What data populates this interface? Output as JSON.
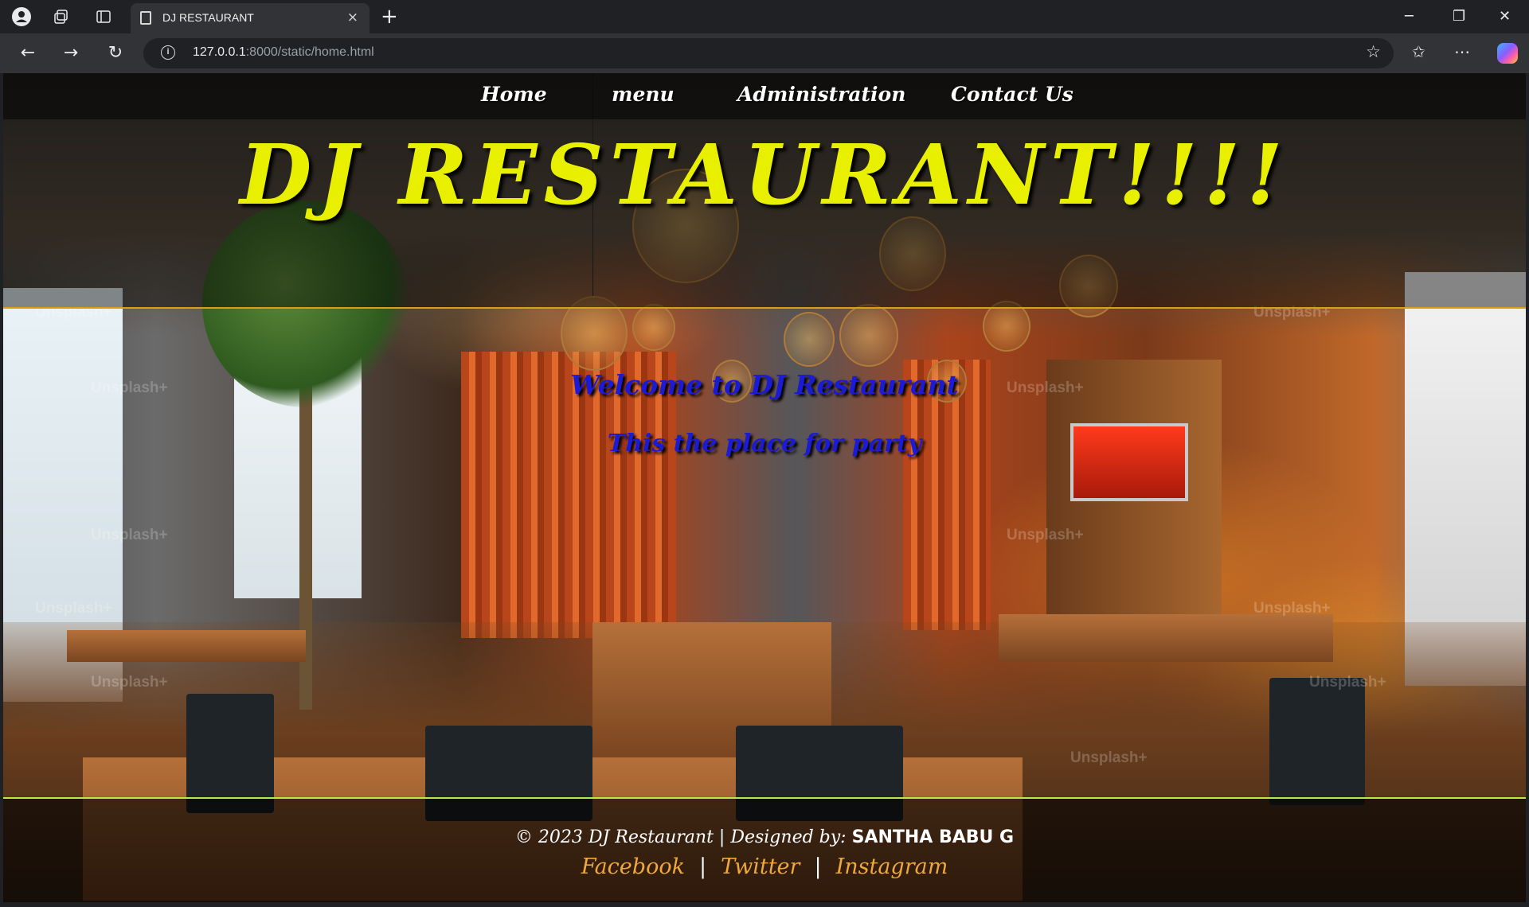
{
  "browser": {
    "tab_title": "DJ RESTAURANT",
    "tab_close": "×",
    "new_tab": "+",
    "url_host": "127.0.0.1",
    "url_rest": ":8000/static/home.html",
    "info_icon": "i",
    "minimize": "─",
    "restore": "❐",
    "close": "✕",
    "back": "←",
    "forward": "→",
    "reload": "↻",
    "star": "☆",
    "favorites": "✩",
    "more": "⋯"
  },
  "nav": {
    "items": [
      {
        "label": "Home"
      },
      {
        "label": "menu"
      },
      {
        "label": "Administration"
      },
      {
        "label": "Contact Us"
      }
    ]
  },
  "hero": {
    "title": "DJ RESTAURANT!!!!",
    "welcome": "Welcome to DJ Restaurant",
    "tagline": "This the place for party"
  },
  "footer": {
    "copyright_prefix": "© 2023 DJ Restaurant | Designed by: ",
    "designer": "SANTHA BABU G",
    "social": [
      {
        "label": "Facebook"
      },
      {
        "label": "Twitter"
      },
      {
        "label": "Instagram"
      }
    ],
    "separator": "|"
  },
  "watermark": "Unsplash+"
}
